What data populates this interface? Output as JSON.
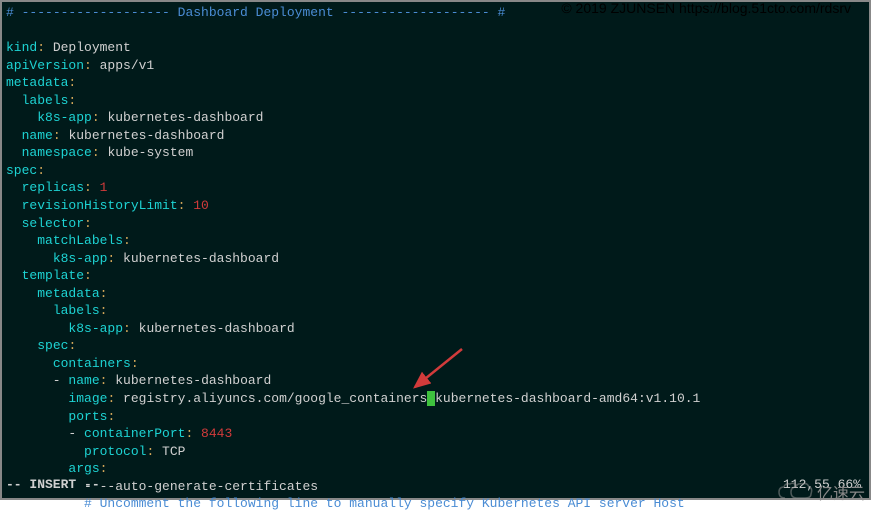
{
  "watermark": "© 2019 ZJUNSEN https://blog.51cto.com/rdsrv",
  "header": {
    "prefix": "# ",
    "dashes1": "------------------- ",
    "title": "Dashboard Deployment",
    "dashes2": " ------------------- #"
  },
  "yaml": {
    "kind_key": "kind",
    "kind_val": "Deployment",
    "apiVersion_key": "apiVersion",
    "apiVersion_val": "apps/v1",
    "metadata_key": "metadata",
    "labels_key": "labels",
    "k8sapp_key": "k8s-app",
    "k8sapp_val": "kubernetes-dashboard",
    "name_key": "name",
    "name_val": "kubernetes-dashboard",
    "namespace_key": "namespace",
    "namespace_val": "kube-system",
    "spec_key": "spec",
    "replicas_key": "replicas",
    "replicas_val": "1",
    "revisionHistoryLimit_key": "revisionHistoryLimit",
    "revisionHistoryLimit_val": "10",
    "selector_key": "selector",
    "matchLabels_key": "matchLabels",
    "template_key": "template",
    "containers_key": "containers",
    "image_key": "image",
    "image_val_pre": "registry.aliyuncs.com/google_containers",
    "image_cursor": "/",
    "image_val_post": "kubernetes-dashboard-amd64:v1.10.1",
    "ports_key": "ports",
    "containerPort_key": "containerPort",
    "containerPort_val": "8443",
    "protocol_key": "protocol",
    "protocol_val": "TCP",
    "args_key": "args",
    "args_val": "--auto-generate-certificates",
    "comment": "# Uncomment the following line to manually specify Kubernetes API server Host"
  },
  "status": {
    "mode": "-- INSERT --",
    "position": "112,55",
    "percent": "66%"
  },
  "logo_text": "亿速云"
}
